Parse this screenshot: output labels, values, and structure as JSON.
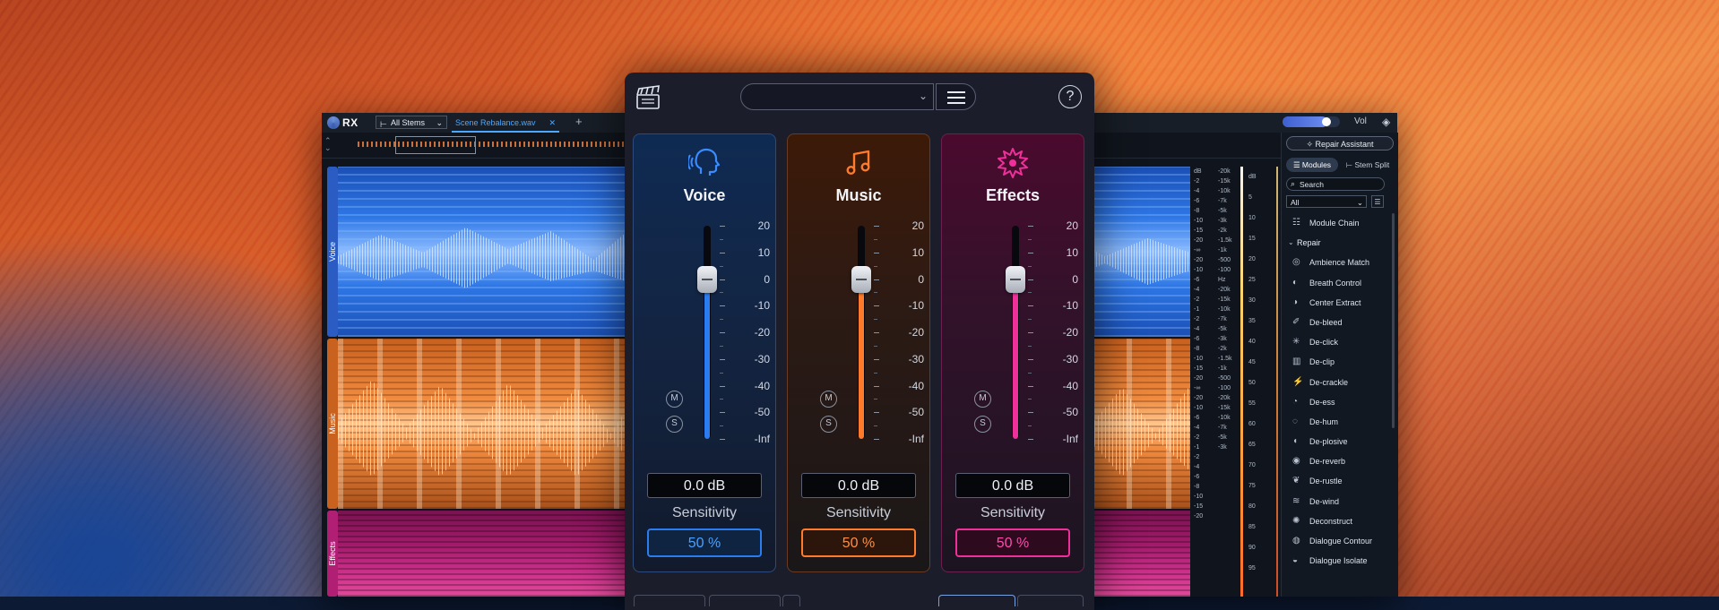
{
  "colors": {
    "voice": "#2b7cf0",
    "music": "#ff7a2a",
    "effects": "#f0309a"
  },
  "rx": {
    "logo": "RX",
    "stems_dropdown": "All Stems",
    "file_tab": "Scene Rebalance.wav",
    "file_tab_close": "✕",
    "new_tab": "+",
    "vol_label": "Vol",
    "vol_level": 0.78,
    "lanes": [
      "Voice",
      "Music",
      "Effects"
    ],
    "db_scale_1": [
      "dB",
      "-2",
      "-4",
      "-6",
      "-8",
      "-10",
      "-15",
      "-20",
      "-∞",
      "-20",
      "-10",
      "-6",
      "-4",
      "-2",
      "-1",
      "-2",
      "-4",
      "-6",
      "-8",
      "-10",
      "-15",
      "-20",
      "-∞",
      "-20",
      "-10",
      "-6",
      "-4",
      "-2",
      "-1",
      "-2",
      "-4",
      "-6",
      "-8",
      "-10",
      "-15",
      "-20"
    ],
    "hz_scale": [
      "-20k",
      "-15k",
      "-10k",
      "-7k",
      "-5k",
      "-3k",
      "-2k",
      "-1.5k",
      "-1k",
      "-500",
      "-100",
      "Hz",
      "-20k",
      "-15k",
      "-10k",
      "-7k",
      "-5k",
      "-3k",
      "-2k",
      "-1.5k",
      "-1k",
      "-500",
      "-100",
      "-20k",
      "-15k",
      "-10k",
      "-7k",
      "-5k",
      "-3k"
    ],
    "db_scale_2": [
      "dB",
      "5",
      "10",
      "15",
      "20",
      "25",
      "30",
      "35",
      "40",
      "45",
      "50",
      "55",
      "60",
      "65",
      "70",
      "75",
      "80",
      "85",
      "90",
      "95"
    ],
    "sidebar": {
      "repair_assistant": "Repair Assistant",
      "tab_modules": "Modules",
      "tab_stem_split": "Stem Split",
      "search_placeholder": "Search",
      "filter": "All",
      "modules": [
        {
          "label": "Module Chain",
          "icon": "☷",
          "category": false
        },
        {
          "label": "Repair",
          "icon": "⌄",
          "category": true
        },
        {
          "label": "Ambience Match",
          "icon": "◎",
          "category": false
        },
        {
          "label": "Breath Control",
          "icon": "◐",
          "category": false
        },
        {
          "label": "Center Extract",
          "icon": "◑",
          "category": false
        },
        {
          "label": "De-bleed",
          "icon": "✐",
          "category": false
        },
        {
          "label": "De-click",
          "icon": "✳",
          "category": false
        },
        {
          "label": "De-clip",
          "icon": "▥",
          "category": false
        },
        {
          "label": "De-crackle",
          "icon": "⚡",
          "category": false
        },
        {
          "label": "De-ess",
          "icon": "◔",
          "category": false
        },
        {
          "label": "De-hum",
          "icon": "◌",
          "category": false
        },
        {
          "label": "De-plosive",
          "icon": "◖",
          "category": false
        },
        {
          "label": "De-reverb",
          "icon": "◉",
          "category": false
        },
        {
          "label": "De-rustle",
          "icon": "❦",
          "category": false
        },
        {
          "label": "De-wind",
          "icon": "≋",
          "category": false
        },
        {
          "label": "Deconstruct",
          "icon": "✺",
          "category": false
        },
        {
          "label": "Dialogue Contour",
          "icon": "◍",
          "category": false
        },
        {
          "label": "Dialogue Isolate",
          "icon": "◒",
          "category": false
        }
      ]
    }
  },
  "plugin": {
    "help": "?",
    "scale_labels": [
      "20",
      "10",
      "0",
      "-10",
      "-20",
      "-30",
      "-40",
      "-50",
      "-Inf"
    ],
    "panels": [
      {
        "key": "voice",
        "title": "Voice",
        "gain": "0.0 dB",
        "sensitivity_label": "Sensitivity",
        "sensitivity": "50 %",
        "mute": "M",
        "solo": "S",
        "fader_value_db": 0
      },
      {
        "key": "music",
        "title": "Music",
        "gain": "0.0 dB",
        "sensitivity_label": "Sensitivity",
        "sensitivity": "50 %",
        "mute": "M",
        "solo": "S",
        "fader_value_db": 0
      },
      {
        "key": "effects",
        "title": "Effects",
        "gain": "0.0 dB",
        "sensitivity_label": "Sensitivity",
        "sensitivity": "50 %",
        "mute": "M",
        "solo": "S",
        "fader_value_db": 0
      }
    ]
  }
}
